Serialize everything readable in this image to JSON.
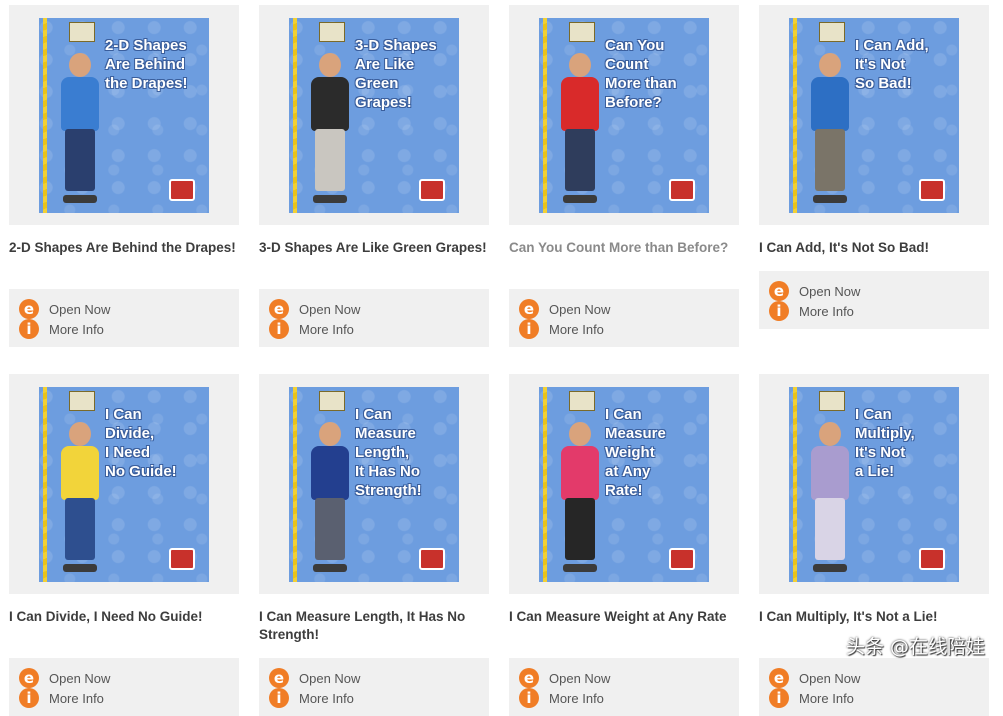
{
  "books": [
    {
      "title": "2-D Shapes Are Behind the Drapes!",
      "cover_text": "2-D Shapes\nAre Behind\nthe Drapes!",
      "shirt": "#3a7dd1",
      "pants": "#2a3f6e",
      "muted": false
    },
    {
      "title": "3-D Shapes Are Like Green Grapes!",
      "cover_text": "3-D Shapes\nAre Like\nGreen\nGrapes!",
      "shirt": "#2b2b2b",
      "pants": "#c9c6c0",
      "muted": false
    },
    {
      "title": "Can You Count More than Before?",
      "cover_text": "Can You\nCount\nMore than\nBefore?",
      "shirt": "#d92a2a",
      "pants": "#2f3d5c",
      "muted": true
    },
    {
      "title": "I Can Add, It's Not So Bad!",
      "cover_text": "I Can Add,\nIt's Not\nSo Bad!",
      "shirt": "#2d6fc4",
      "pants": "#7a7468",
      "muted": false
    },
    {
      "title": "I Can Divide, I Need No Guide!",
      "cover_text": "I Can\nDivide,\nI Need\nNo Guide!",
      "shirt": "#f2d43a",
      "pants": "#2e4f8f",
      "muted": false
    },
    {
      "title": "I Can Measure Length, It Has No Strength!",
      "cover_text": "I Can\nMeasure\nLength,\nIt Has No\nStrength!",
      "shirt": "#233f8f",
      "pants": "#5a6070",
      "muted": false
    },
    {
      "title": "I Can Measure Weight at Any Rate",
      "cover_text": "I Can\nMeasure\nWeight\nat Any\nRate!",
      "shirt": "#e33a6a",
      "pants": "#262626",
      "muted": false
    },
    {
      "title": "I Can Multiply, It's Not a Lie!",
      "cover_text": "I Can\nMultiply,\nIt's Not\na Lie!",
      "shirt": "#a99ccf",
      "pants": "#d9d4e6",
      "muted": false
    }
  ],
  "actions": {
    "open": "Open Now",
    "info": "More Info"
  },
  "icons": {
    "open": "e",
    "info": "i"
  },
  "watermark": "头条 @在线陪娃",
  "colors": {
    "accent": "#f07d26",
    "cover_bg": "#6d9ddf",
    "stripe": "#f2d033"
  }
}
